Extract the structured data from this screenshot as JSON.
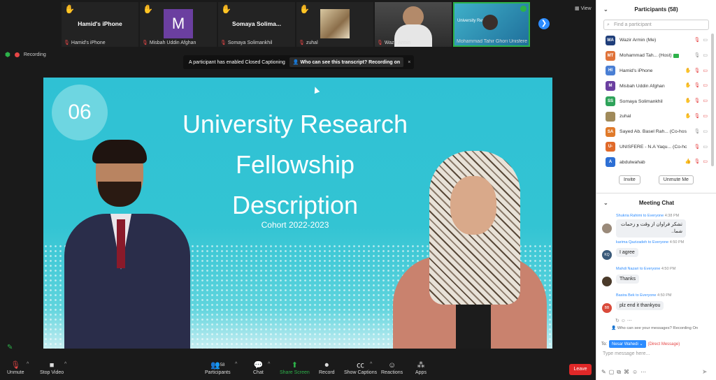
{
  "thumbnails": [
    {
      "name": "Hamid's iPhone",
      "label": "Hamid's iPhone",
      "kind": "name"
    },
    {
      "name": "",
      "label": "Misbah Uddin Afghan",
      "avatar": "M",
      "kind": "avatar"
    },
    {
      "name": "Somaya Solima...",
      "label": "Somaya Solimankhil",
      "kind": "name"
    },
    {
      "name": "",
      "label": "zuhal",
      "kind": "image"
    },
    {
      "name": "",
      "label": "Wazir Armin",
      "kind": "video"
    },
    {
      "name": "",
      "label": "Mohammad Tahir Ghori Unisfere",
      "kind": "slide",
      "slide_text": "University Res"
    }
  ],
  "view_label": "View",
  "recording_label": "Recording",
  "cc_banner": {
    "message": "A participant has enabled Closed Captioning",
    "link": "Who can see this transcript? Recording on",
    "close": "×"
  },
  "slide": {
    "number": "06",
    "title_lines": [
      "University Research",
      "Fellowship",
      "Description"
    ],
    "cohort": "Cohort 2022-2023"
  },
  "toolbar": {
    "unmute": "Unmute",
    "stop_video": "Stop Video",
    "participants": "Participants",
    "participants_count": "58",
    "chat": "Chat",
    "share_screen": "Share Screen",
    "record": "Record",
    "show_captions": "Show Captions",
    "reactions": "Reactions",
    "apps": "Apps",
    "leave": "Leave"
  },
  "participants_panel": {
    "title": "Participants (58)",
    "search_placeholder": "Find a participant",
    "participants": [
      {
        "initials": "WA",
        "name": "Wazir Armin (Me)",
        "color": "#1f3e7a"
      },
      {
        "initials": "MT",
        "name": "Mohammad Tah... (Host)",
        "color": "#e0733a"
      },
      {
        "initials": "HI",
        "name": "Hamid's iPhone",
        "color": "#4a7fd4"
      },
      {
        "initials": "M",
        "name": "Misbah Uddin Afghan",
        "color": "#6b3fa0"
      },
      {
        "initials": "SS",
        "name": "Somaya Solimankhil",
        "color": "#2ea35a"
      },
      {
        "initials": "",
        "name": "zuhal",
        "color": "#a08a5a"
      },
      {
        "initials": "SA",
        "name": "Sayed Ab. Basel Rah... (Co-host)",
        "color": "#e07a2a"
      },
      {
        "initials": "U-",
        "name": "UNISFERE - N.A Yaqu... (Co-host)",
        "color": "#e06a2a"
      },
      {
        "initials": "A",
        "name": "abdulwahab",
        "color": "#2d6fd4"
      }
    ],
    "invite": "Invite",
    "unmute_me": "Unmute Me"
  },
  "chat": {
    "title": "Meeting Chat",
    "messages": [
      {
        "from": "Shukria Rahimi",
        "to": "to Everyone",
        "time": "4:38 PM",
        "text": "تشکر فراوان از وقت و زحمات شما..",
        "avatar": "",
        "avatar_color": "#9a8a7a"
      },
      {
        "from": "karima Qazizadeh",
        "to": "to Everyone",
        "time": "4:50 PM",
        "text": "I agree",
        "avatar": "KQ",
        "avatar_color": "#3a5a7a"
      },
      {
        "from": "Mahdi Nazari",
        "to": "to Everyone",
        "time": "4:50 PM",
        "text": "Thanks",
        "avatar": "",
        "avatar_color": "#4a3a2a"
      },
      {
        "from": "Basira Bek",
        "to": "to Everyone",
        "time": "4:50 PM",
        "text": "plz end it thankyou",
        "avatar": "BB",
        "avatar_color": "#d94a3a"
      }
    ],
    "recording_note": "Who can see your messages? Recording On",
    "to_label": "To:",
    "recipient": "Nesar Wahedi",
    "direct_label": "(Direct Message)",
    "input_placeholder": "Type message here..."
  }
}
